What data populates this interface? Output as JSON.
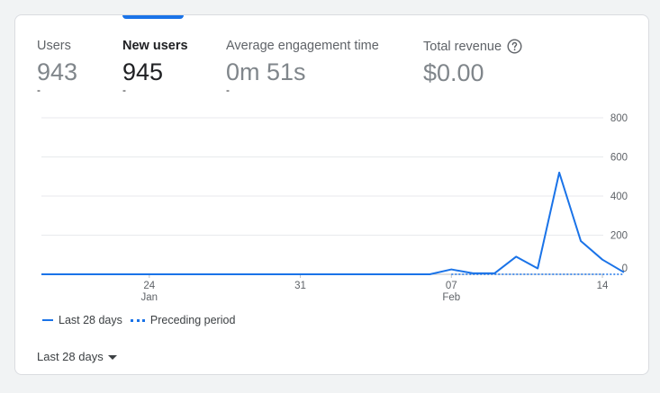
{
  "metrics": [
    {
      "label": "Users",
      "value": "943",
      "delta": "-",
      "active": false
    },
    {
      "label": "New users",
      "value": "945",
      "delta": "-",
      "active": true
    },
    {
      "label": "Average engagement time",
      "value": "0m 51s",
      "delta": "-",
      "active": false
    },
    {
      "label": "Total revenue",
      "value": "$0.00",
      "delta": "",
      "active": false
    }
  ],
  "legend": {
    "current": "Last 28 days",
    "previous": "Preceding period"
  },
  "date_range": {
    "selected": "Last 28 days"
  },
  "colors": {
    "accent": "#1a73e8",
    "grid": "#e8eaed",
    "text_muted": "#5f6368"
  },
  "chart_data": {
    "type": "line",
    "x": [
      "Jan 19",
      "Jan 20",
      "Jan 21",
      "Jan 22",
      "Jan 23",
      "Jan 24",
      "Jan 25",
      "Jan 26",
      "Jan 27",
      "Jan 28",
      "Jan 29",
      "Jan 30",
      "Jan 31",
      "Feb 1",
      "Feb 2",
      "Feb 3",
      "Feb 4",
      "Feb 5",
      "Feb 6",
      "Feb 7",
      "Feb 8",
      "Feb 9",
      "Feb 10",
      "Feb 11",
      "Feb 12",
      "Feb 13",
      "Feb 14",
      "Feb 15"
    ],
    "x_tick_labels": [
      {
        "index": 5,
        "day": "24",
        "month": "Jan"
      },
      {
        "index": 12,
        "day": "31",
        "month": ""
      },
      {
        "index": 19,
        "day": "07",
        "month": "Feb"
      },
      {
        "index": 26,
        "day": "14",
        "month": ""
      }
    ],
    "series": [
      {
        "name": "Last 28 days",
        "style": "solid",
        "values": [
          0,
          0,
          0,
          0,
          0,
          0,
          0,
          0,
          0,
          0,
          0,
          0,
          0,
          0,
          0,
          0,
          0,
          0,
          0,
          25,
          5,
          5,
          90,
          30,
          520,
          170,
          75,
          10
        ]
      },
      {
        "name": "Preceding period",
        "style": "dashed",
        "values": [
          null,
          null,
          null,
          null,
          null,
          null,
          null,
          null,
          null,
          null,
          null,
          null,
          null,
          null,
          null,
          null,
          null,
          null,
          null,
          0,
          0,
          0,
          0,
          0,
          0,
          0,
          0,
          0
        ]
      }
    ],
    "y_ticks": [
      0,
      200,
      400,
      600,
      800
    ],
    "ylim": [
      0,
      800
    ],
    "grid": true,
    "y_axis_side": "right"
  }
}
